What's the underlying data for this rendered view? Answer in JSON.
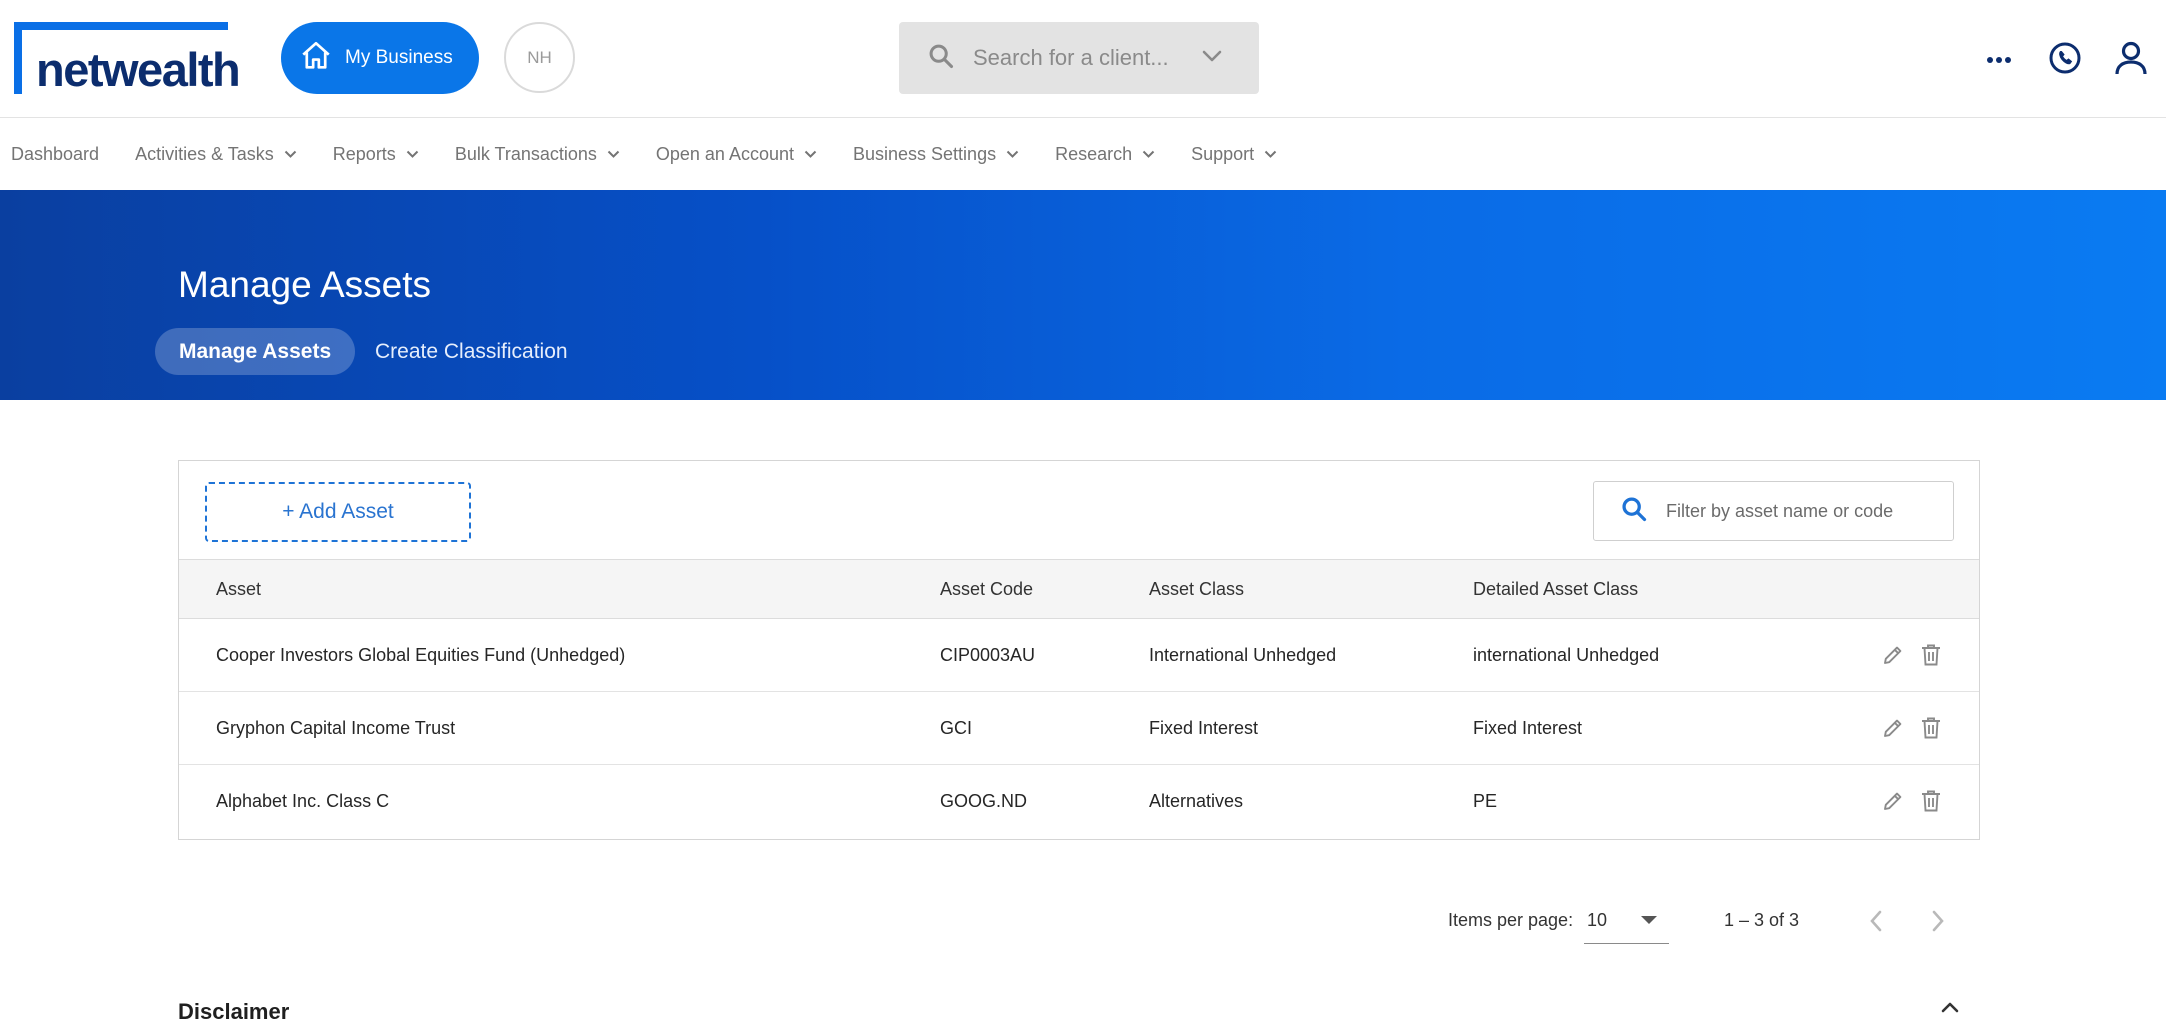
{
  "brand": {
    "logo_text": "netwealth"
  },
  "header": {
    "my_business_label": "My Business",
    "avatar_initials": "NH",
    "search_placeholder": "Search for a client..."
  },
  "nav": {
    "items": [
      {
        "label": "Dashboard",
        "has_dropdown": false
      },
      {
        "label": "Activities & Tasks",
        "has_dropdown": true
      },
      {
        "label": "Reports",
        "has_dropdown": true
      },
      {
        "label": "Bulk Transactions",
        "has_dropdown": true
      },
      {
        "label": "Open an Account",
        "has_dropdown": true
      },
      {
        "label": "Business Settings",
        "has_dropdown": true
      },
      {
        "label": "Research",
        "has_dropdown": true
      },
      {
        "label": "Support",
        "has_dropdown": true
      }
    ]
  },
  "hero": {
    "title": "Manage Assets",
    "tabs": [
      {
        "label": "Manage Assets",
        "active": true
      },
      {
        "label": "Create Classification",
        "active": false
      }
    ]
  },
  "toolbar": {
    "add_label": "+ Add Asset",
    "filter_placeholder": "Filter by asset name or code"
  },
  "table": {
    "columns": [
      "Asset",
      "Asset Code",
      "Asset Class",
      "Detailed Asset Class"
    ],
    "rows": [
      [
        "Cooper Investors Global Equities Fund (Unhedged)",
        "CIP0003AU",
        "International Unhedged",
        "international Unhedged"
      ],
      [
        "Gryphon Capital Income Trust",
        "GCI",
        "Fixed Interest",
        "Fixed Interest"
      ],
      [
        "Alphabet Inc. Class C",
        "GOOG.ND",
        "Alternatives",
        "PE"
      ]
    ]
  },
  "pagination": {
    "items_per_page_label": "Items per page:",
    "items_per_page_value": "10",
    "range_label": "1 – 3 of 3"
  },
  "disclaimer": {
    "title": "Disclaimer"
  },
  "colors": {
    "brand_blue": "#0a76e8",
    "logo_navy": "#0c2d6e",
    "hero_start": "#0a3fa0",
    "hero_end": "#0a7bf2"
  }
}
